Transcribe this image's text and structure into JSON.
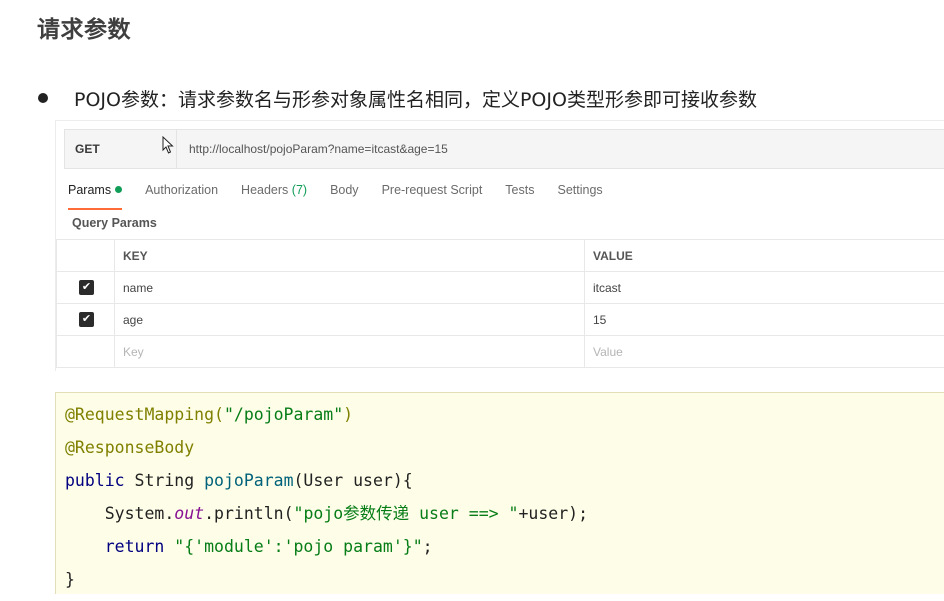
{
  "heading": "请求参数",
  "bullet": "POJO参数：请求参数名与形参对象属性名相同，定义POJO类型形参即可接收参数",
  "postman": {
    "method": "GET",
    "url": "http://localhost/pojoParam?name=itcast&age=15",
    "tabs": {
      "params": "Params",
      "authorization": "Authorization",
      "headers": "Headers",
      "headers_count": "(7)",
      "body": "Body",
      "prerequest": "Pre-request Script",
      "tests": "Tests",
      "settings": "Settings"
    },
    "query_params_label": "Query Params",
    "columns": {
      "key": "KEY",
      "value": "VALUE"
    },
    "rows": [
      {
        "key": "name",
        "value": "itcast",
        "checked": true
      },
      {
        "key": "age",
        "value": "15",
        "checked": true
      }
    ],
    "placeholder": {
      "key": "Key",
      "value": "Value"
    }
  },
  "code": {
    "l1_ann": "@RequestMapping(",
    "l1_str": "\"/pojoParam\"",
    "l1_end": ")",
    "l2_ann": "@ResponseBody",
    "l3_kw": "public",
    "l3_type": " String ",
    "l3_fn": "pojoParam",
    "l3_rest": "(User user){",
    "l4_indent": "    ",
    "l4_sys": "System.",
    "l4_field": "out",
    "l4_call": ".println(",
    "l4_str": "\"pojo参数传递 user ==> \"",
    "l4_end": "+user);",
    "l5_indent": "    ",
    "l5_kw": "return",
    "l5_str": " \"{'module':'pojo param'}\"",
    "l5_end": ";",
    "l6": "}"
  }
}
